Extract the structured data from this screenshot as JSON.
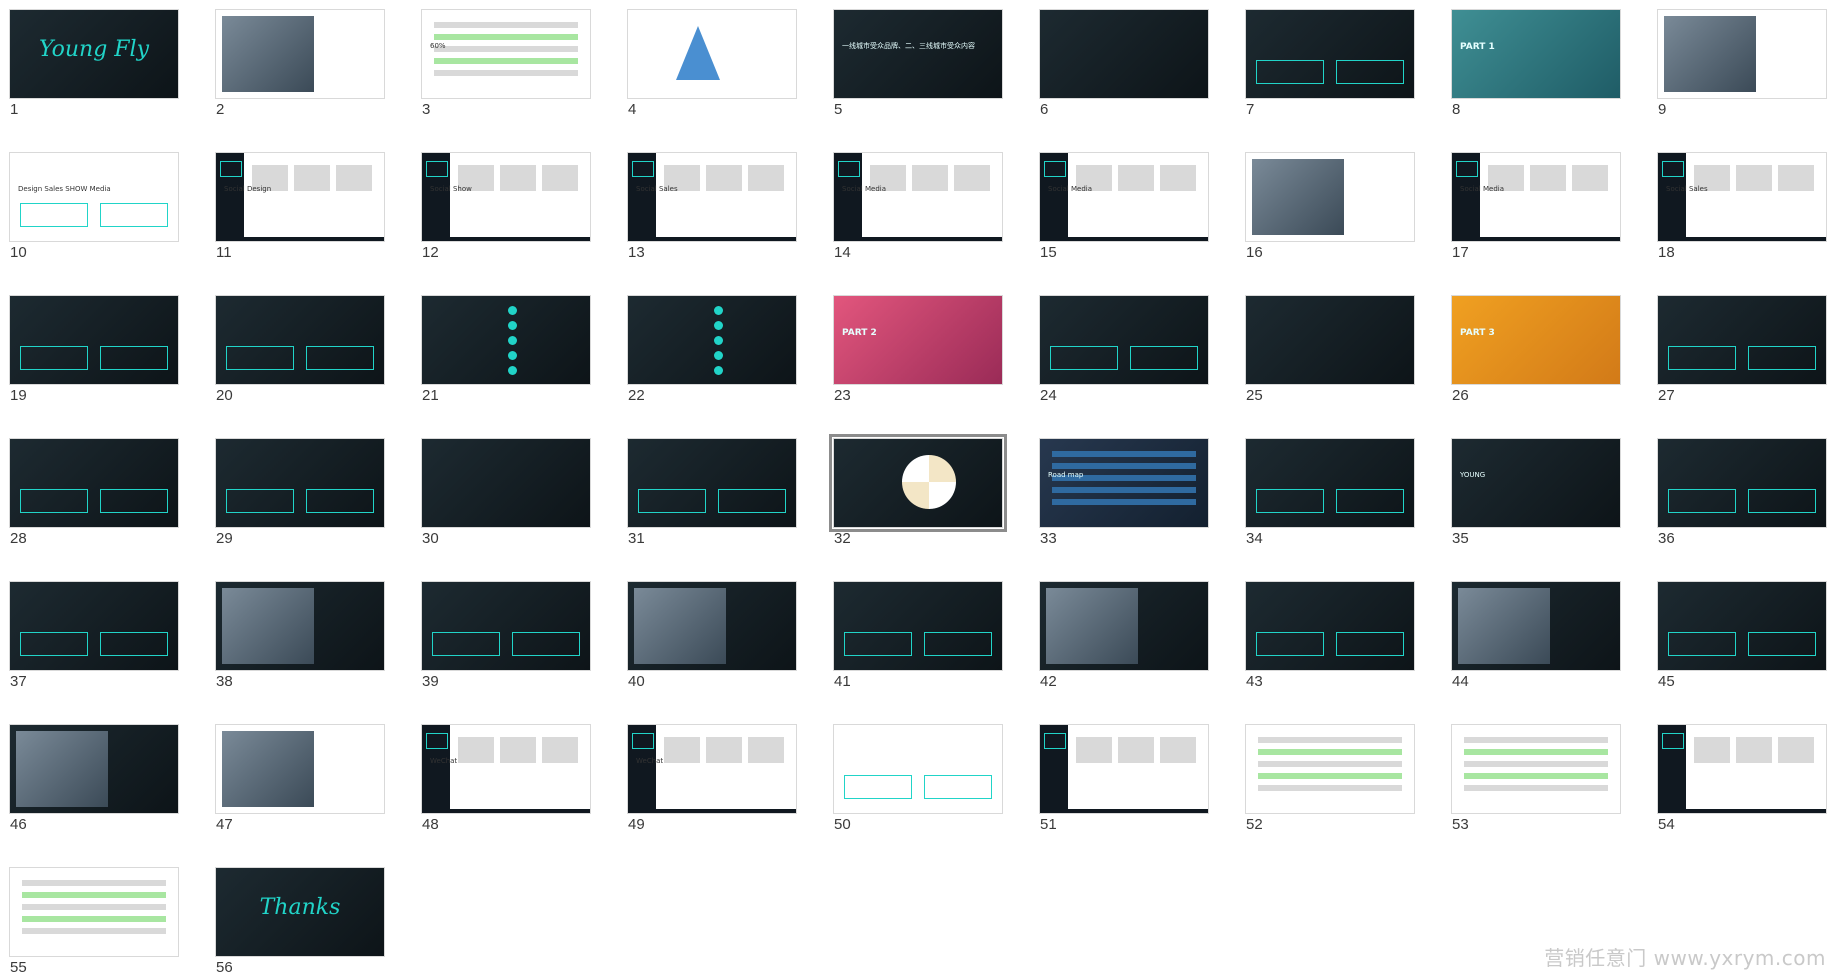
{
  "watermark": "营销任意门 www.yxrym.com",
  "colors": {
    "accent": "#21d4c8",
    "dark": "#101820",
    "background": "#ffffff"
  },
  "selected_slide": 32,
  "slides": [
    {
      "number": "1",
      "theme": "dark",
      "kind": "script",
      "text": "Young Fly"
    },
    {
      "number": "2",
      "theme": "light",
      "kind": "photo",
      "text": ""
    },
    {
      "number": "3",
      "theme": "light",
      "kind": "chart",
      "text": "60%"
    },
    {
      "number": "4",
      "theme": "light",
      "kind": "triangle",
      "text": ""
    },
    {
      "number": "5",
      "theme": "dark",
      "kind": "text",
      "text": "一线城市受众品牌、二、三线城市受众内容"
    },
    {
      "number": "6",
      "theme": "dark",
      "kind": "text",
      "text": ""
    },
    {
      "number": "7",
      "theme": "dark",
      "kind": "boxes",
      "text": ""
    },
    {
      "number": "8",
      "theme": "teal",
      "kind": "part",
      "text": "PART 1"
    },
    {
      "number": "9",
      "theme": "light",
      "kind": "photo",
      "text": ""
    },
    {
      "number": "10",
      "theme": "light",
      "kind": "diagram",
      "text": "Design  Sales  SHOW  Media"
    },
    {
      "number": "11",
      "theme": "light",
      "kind": "sidebar",
      "text": "Social Design"
    },
    {
      "number": "12",
      "theme": "light",
      "kind": "sidebar",
      "text": "Social Show"
    },
    {
      "number": "13",
      "theme": "light",
      "kind": "sidebar",
      "text": "Social Sales"
    },
    {
      "number": "14",
      "theme": "light",
      "kind": "sidebar",
      "text": "Social Media"
    },
    {
      "number": "15",
      "theme": "light",
      "kind": "sidebar",
      "text": "Social Media"
    },
    {
      "number": "16",
      "theme": "light",
      "kind": "photo",
      "text": ""
    },
    {
      "number": "17",
      "theme": "light",
      "kind": "sidebar",
      "text": "Social Media"
    },
    {
      "number": "18",
      "theme": "light",
      "kind": "sidebar",
      "text": "Social Sales"
    },
    {
      "number": "19",
      "theme": "dark",
      "kind": "boxes",
      "text": ""
    },
    {
      "number": "20",
      "theme": "dark",
      "kind": "boxes",
      "text": ""
    },
    {
      "number": "21",
      "theme": "dark",
      "kind": "dots",
      "text": ""
    },
    {
      "number": "22",
      "theme": "dark",
      "kind": "dots",
      "text": ""
    },
    {
      "number": "23",
      "theme": "pink",
      "kind": "part",
      "text": "PART 2"
    },
    {
      "number": "24",
      "theme": "dark",
      "kind": "boxes",
      "text": ""
    },
    {
      "number": "25",
      "theme": "dark",
      "kind": "text",
      "text": ""
    },
    {
      "number": "26",
      "theme": "orange",
      "kind": "part",
      "text": "PART 3"
    },
    {
      "number": "27",
      "theme": "dark",
      "kind": "boxes",
      "text": ""
    },
    {
      "number": "28",
      "theme": "dark",
      "kind": "boxes",
      "text": ""
    },
    {
      "number": "29",
      "theme": "dark",
      "kind": "boxes",
      "text": ""
    },
    {
      "number": "30",
      "theme": "dark",
      "kind": "text",
      "text": ""
    },
    {
      "number": "31",
      "theme": "dark",
      "kind": "boxes",
      "text": ""
    },
    {
      "number": "32",
      "theme": "dark",
      "kind": "pie",
      "text": ""
    },
    {
      "number": "33",
      "theme": "navy",
      "kind": "table",
      "text": "Road map"
    },
    {
      "number": "34",
      "theme": "dark",
      "kind": "boxes",
      "text": ""
    },
    {
      "number": "35",
      "theme": "dark",
      "kind": "text",
      "text": "YOUNG"
    },
    {
      "number": "36",
      "theme": "dark",
      "kind": "boxes",
      "text": ""
    },
    {
      "number": "37",
      "theme": "dark",
      "kind": "boxes",
      "text": ""
    },
    {
      "number": "38",
      "theme": "dark",
      "kind": "photo",
      "text": ""
    },
    {
      "number": "39",
      "theme": "dark",
      "kind": "boxes",
      "text": ""
    },
    {
      "number": "40",
      "theme": "dark",
      "kind": "photo",
      "text": ""
    },
    {
      "number": "41",
      "theme": "dark",
      "kind": "boxes",
      "text": ""
    },
    {
      "number": "42",
      "theme": "dark",
      "kind": "photo",
      "text": ""
    },
    {
      "number": "43",
      "theme": "dark",
      "kind": "boxes",
      "text": ""
    },
    {
      "number": "44",
      "theme": "dark",
      "kind": "photo",
      "text": ""
    },
    {
      "number": "45",
      "theme": "dark",
      "kind": "boxes",
      "text": ""
    },
    {
      "number": "46",
      "theme": "dark",
      "kind": "photo",
      "text": ""
    },
    {
      "number": "47",
      "theme": "light",
      "kind": "photo",
      "text": ""
    },
    {
      "number": "48",
      "theme": "light",
      "kind": "sidebar",
      "text": "WeChat"
    },
    {
      "number": "49",
      "theme": "light",
      "kind": "sidebar",
      "text": "WeChat"
    },
    {
      "number": "50",
      "theme": "light",
      "kind": "boxes",
      "text": ""
    },
    {
      "number": "51",
      "theme": "light",
      "kind": "sidebar",
      "text": ""
    },
    {
      "number": "52",
      "theme": "light",
      "kind": "table",
      "text": ""
    },
    {
      "number": "53",
      "theme": "light",
      "kind": "table",
      "text": ""
    },
    {
      "number": "54",
      "theme": "light",
      "kind": "sidebar",
      "text": ""
    },
    {
      "number": "55",
      "theme": "light",
      "kind": "table",
      "text": ""
    },
    {
      "number": "56",
      "theme": "dark",
      "kind": "script",
      "text": "Thanks"
    }
  ]
}
